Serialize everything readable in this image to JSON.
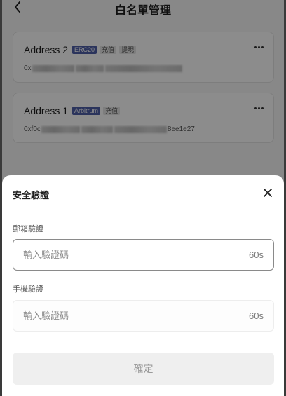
{
  "page": {
    "title": "白名單管理",
    "back_icon": "chevron-left-icon"
  },
  "addresses": [
    {
      "name": "Address 2",
      "network": "ERC20",
      "tags": [
        "充值",
        "提現"
      ],
      "address_prefix": "0x",
      "address_suffix": ""
    },
    {
      "name": "Address 1",
      "network": "Arbitrum",
      "tags": [
        "充值"
      ],
      "address_prefix": "0xf0c",
      "address_suffix": "8ee1e27"
    }
  ],
  "colors": {
    "network_tag": "#4f60a8",
    "overlay": "rgba(0,0,0,0.45)"
  },
  "verify": {
    "title": "安全驗證",
    "email_label": "郵箱驗證",
    "email_placeholder": "輸入驗證碼",
    "email_countdown": "60s",
    "phone_label": "手機驗證",
    "phone_placeholder": "輸入驗證碼",
    "phone_countdown": "60s",
    "confirm_label": "確定",
    "close_icon": "close-icon"
  }
}
